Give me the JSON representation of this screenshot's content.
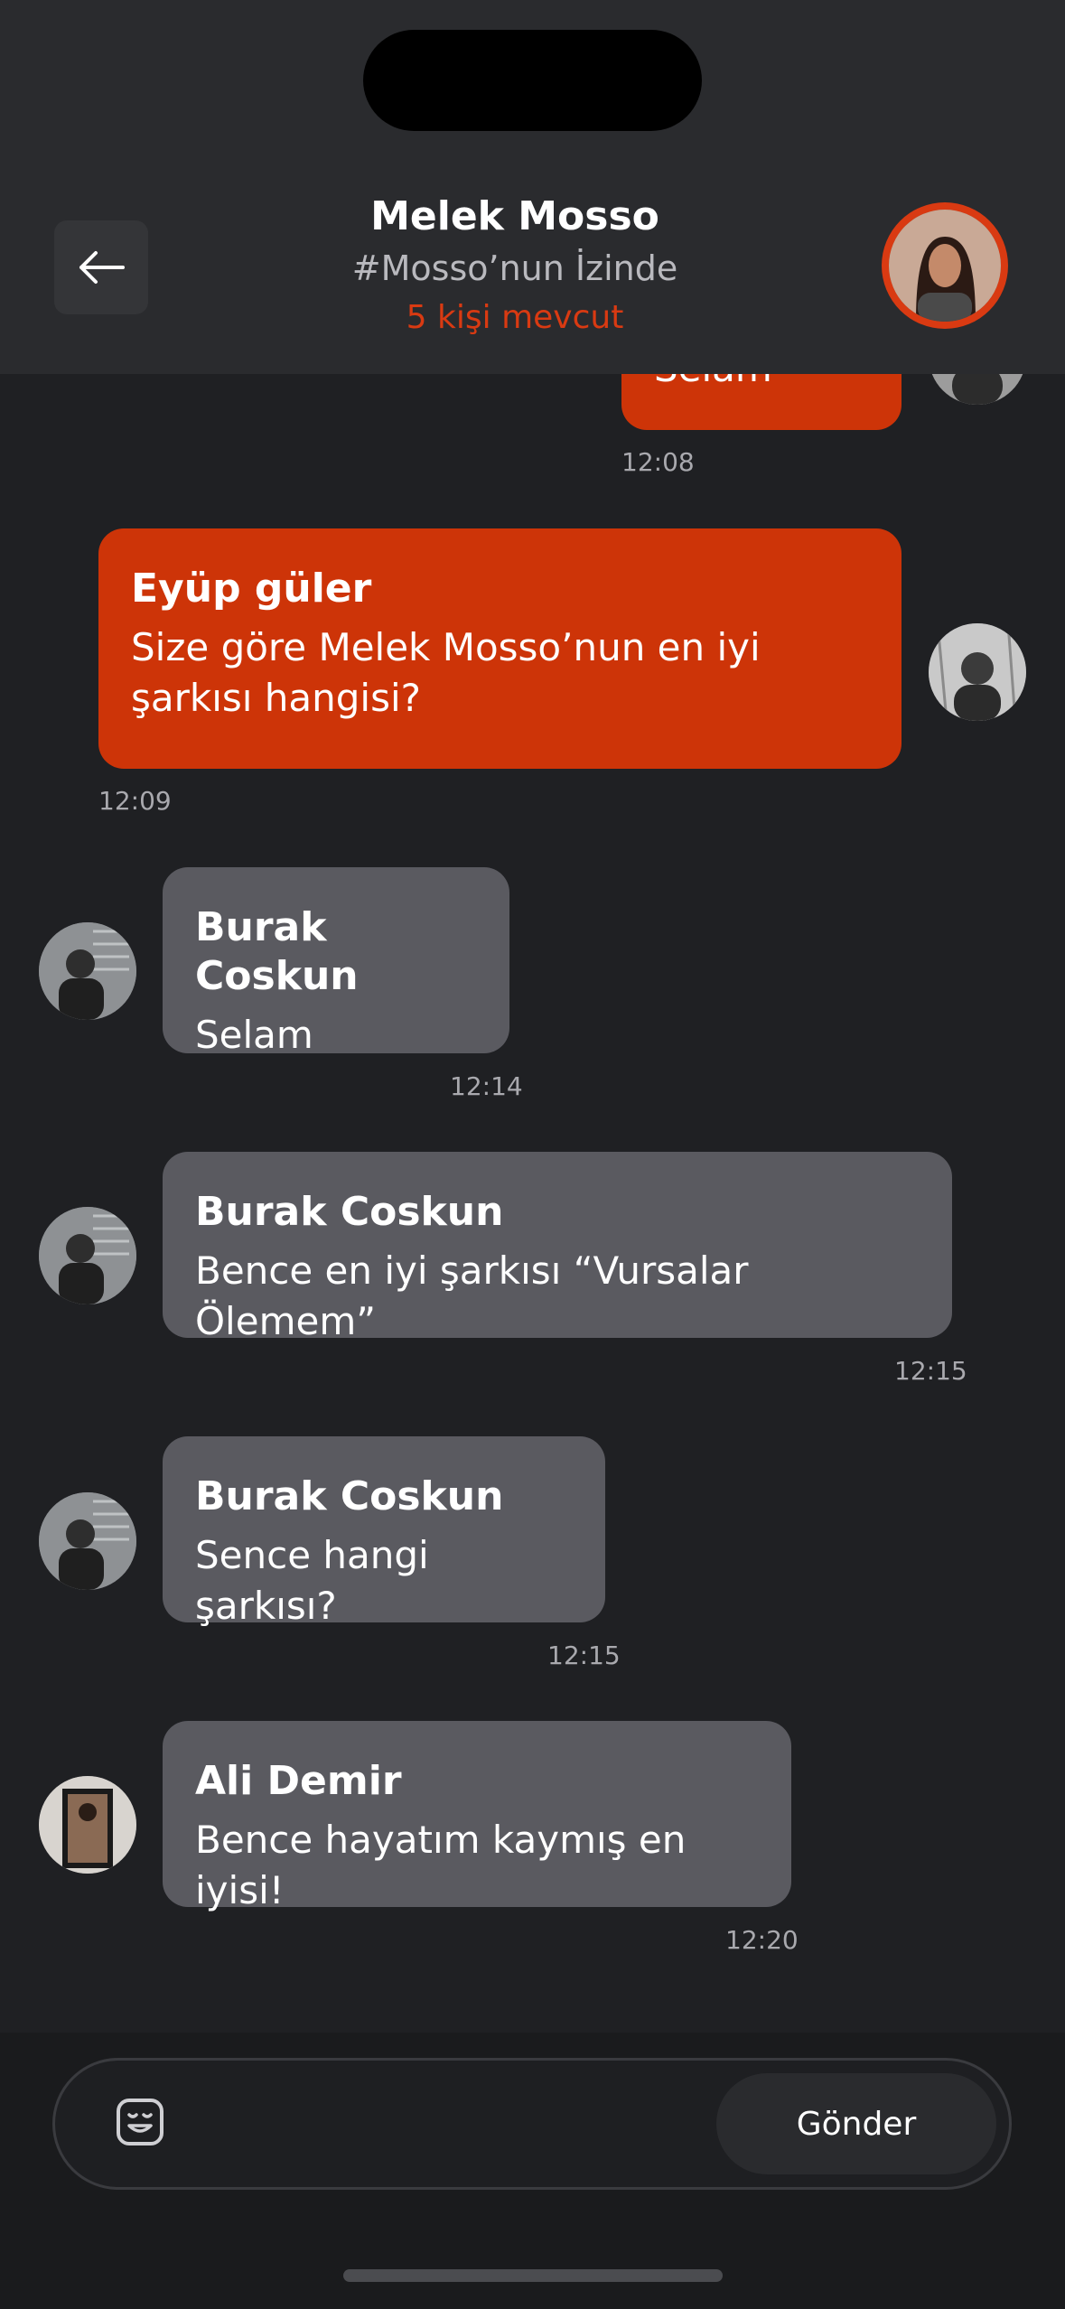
{
  "header": {
    "name": "Melek Mosso",
    "channel": "#Mosso’nun İzinde",
    "members": "5 kişi mevcut",
    "accent": "#d93a12"
  },
  "messages": [
    {
      "sender": "",
      "text": "Selam",
      "time": "12:08",
      "style": "own"
    },
    {
      "sender": "Eyüp güler",
      "text": "Size göre Melek Mosso’nun en iyi şarkısı hangisi?",
      "time": "12:09",
      "style": "own"
    },
    {
      "sender": "Burak Coskun",
      "text": "Selam",
      "time": "12:14",
      "style": "other"
    },
    {
      "sender": "Burak Coskun",
      "text": "Bence en iyi şarkısı “Vursalar Ölemem”",
      "time": "12:15",
      "style": "other"
    },
    {
      "sender": "Burak Coskun",
      "text": "Sence hangi şarkısı?",
      "time": "12:15",
      "style": "other"
    },
    {
      "sender": "Ali Demir",
      "text": "Bence hayatım kaymış en iyisi!",
      "time": "12:20",
      "style": "other"
    }
  ],
  "composer": {
    "send_label": "Gönder",
    "emoji_icon": "emoji-icon"
  },
  "colors": {
    "background": "#1f2023",
    "own_bubble": "#cd3408",
    "other_bubble": "#5a5a60"
  }
}
